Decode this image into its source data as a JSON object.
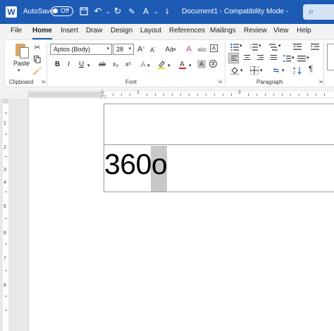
{
  "titlebar": {
    "app_letter": "W",
    "autosave_label": "AutoSave",
    "autosave_state": "Off",
    "document_title": "Document1  -  Compatibility Mode  -",
    "accent": "#1e5bb5"
  },
  "tabs": [
    "File",
    "Home",
    "Insert",
    "Draw",
    "Design",
    "Layout",
    "References",
    "Mailings",
    "Review",
    "View",
    "Help"
  ],
  "active_tab": "Home",
  "ribbon": {
    "clipboard": {
      "paste_label": "Paste",
      "group_label": "Clipboard"
    },
    "font": {
      "font_name": "Aptos (Body)",
      "font_size": "28",
      "group_label": "Font",
      "bold": "B",
      "italic": "I",
      "underline": "U",
      "strike": "ab",
      "subscript": "x₂",
      "superscript": "x²",
      "grow": "A",
      "shrink": "A",
      "case": "Aa"
    },
    "paragraph": {
      "group_label": "Paragraph",
      "pilcrow": "¶"
    }
  },
  "ruler": {
    "numbers": [
      "1",
      "2"
    ]
  },
  "vruler": {
    "numbers": [
      "1",
      "2",
      "3",
      "4",
      "5",
      "6",
      "7",
      "8"
    ]
  },
  "document": {
    "table_cell_text": "360o"
  }
}
